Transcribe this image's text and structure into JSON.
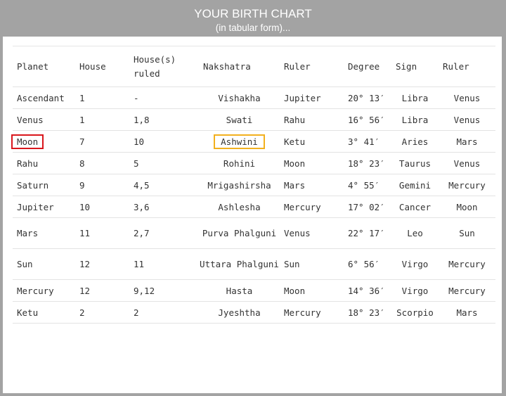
{
  "header": {
    "title": "YOUR BIRTH CHART",
    "subtitle": "(in tabular form)..."
  },
  "table": {
    "headers": [
      "Planet",
      "House",
      "House(s) ruled",
      "Nakshatra",
      "Ruler",
      "Degree",
      "Sign",
      "Ruler"
    ],
    "rows": [
      [
        "Ascendant",
        "1",
        "-",
        "Vishakha",
        "Jupiter",
        "20° 13′",
        "Libra",
        "Venus"
      ],
      [
        "Venus",
        "1",
        "1,8",
        "Swati",
        "Rahu",
        "16° 56′",
        "Libra",
        "Venus"
      ],
      [
        "Moon",
        "7",
        "10",
        "Ashwini",
        "Ketu",
        "3° 41′",
        "Aries",
        "Mars"
      ],
      [
        "Rahu",
        "8",
        "5",
        "Rohini",
        "Moon",
        "18° 23′",
        "Taurus",
        "Venus"
      ],
      [
        "Saturn",
        "9",
        "4,5",
        "Mrigashirsha",
        "Mars",
        "4° 55′",
        "Gemini",
        "Mercury"
      ],
      [
        "Jupiter",
        "10",
        "3,6",
        "Ashlesha",
        "Mercury",
        "17° 02′",
        "Cancer",
        "Moon"
      ],
      [
        "Mars",
        "11",
        "2,7",
        "Purva Phalguni",
        "Venus",
        "22° 17′",
        "Leo",
        "Sun"
      ],
      [
        "Sun",
        "12",
        "11",
        "Uttara Phalguni",
        "Sun",
        "6° 56′",
        "Virgo",
        "Mercury"
      ],
      [
        "Mercury",
        "12",
        "9,12",
        "Hasta",
        "Moon",
        "14° 36′",
        "Virgo",
        "Mercury"
      ],
      [
        "Ketu",
        "2",
        "2",
        "Jyeshtha",
        "Mercury",
        "18° 23′",
        "Scorpio",
        "Mars"
      ]
    ]
  },
  "highlights": {
    "planet_box_color": "#d9161c",
    "nakshatra_box_color": "#f2b01e"
  }
}
